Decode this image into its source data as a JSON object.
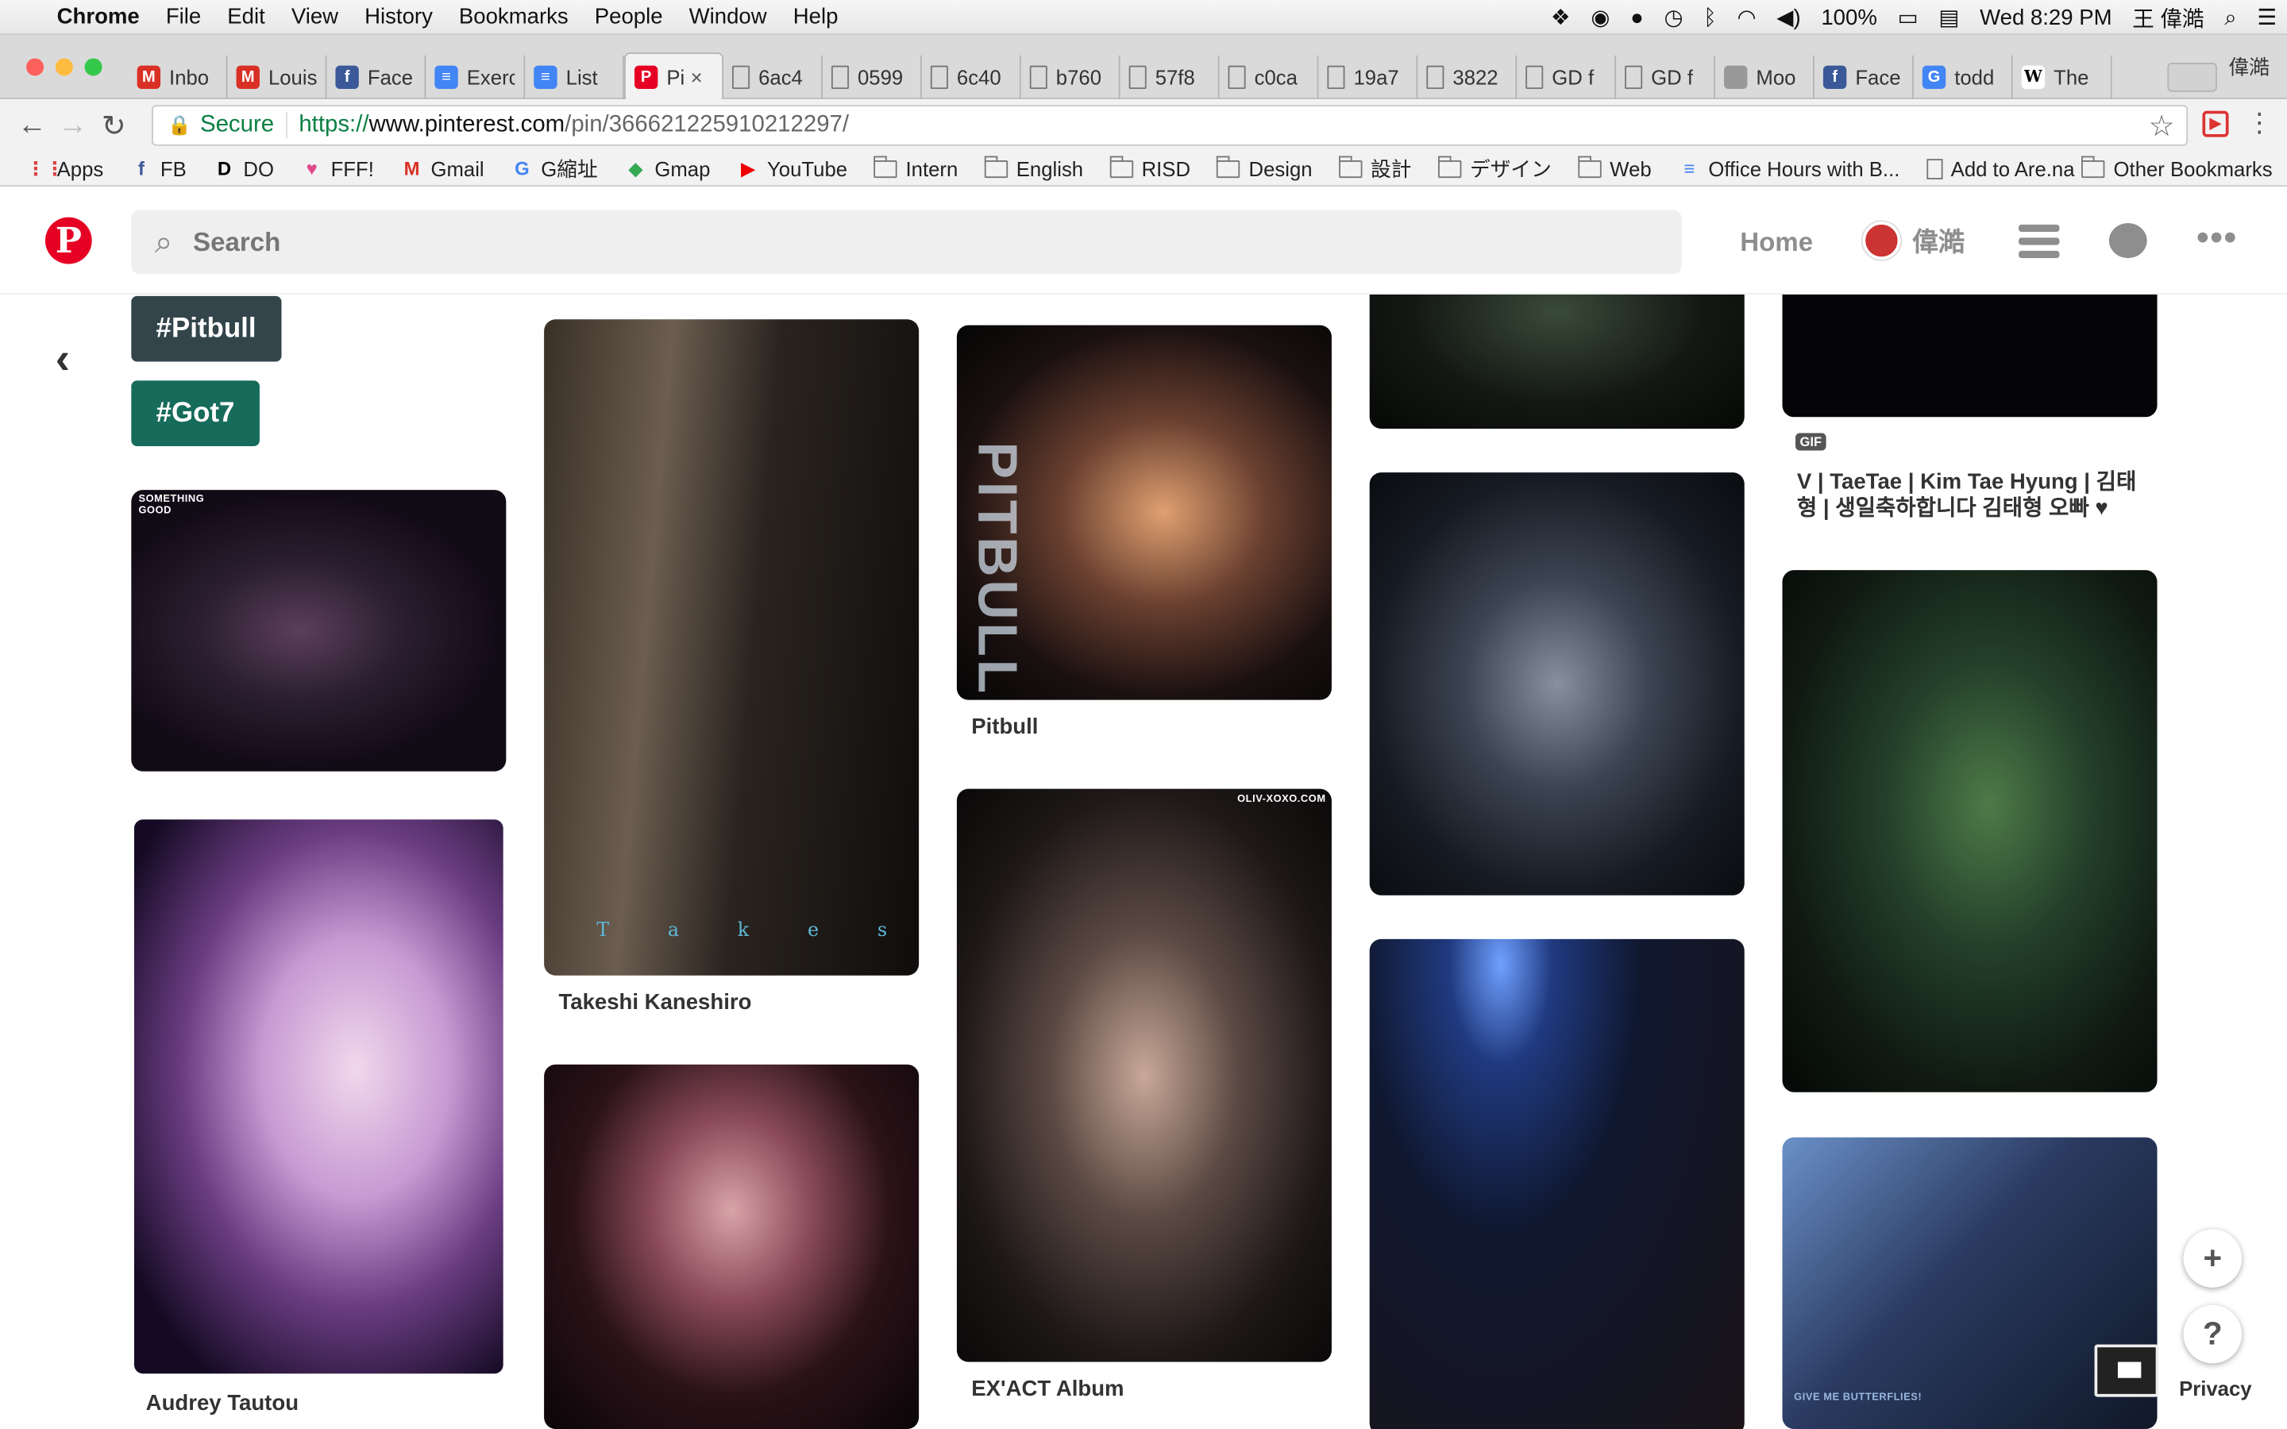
{
  "menubar": {
    "app_name": "Chrome",
    "items": [
      "File",
      "Edit",
      "View",
      "History",
      "Bookmarks",
      "People",
      "Window",
      "Help"
    ],
    "battery": "100%",
    "clock": "Wed 8:29 PM",
    "user": "王 偉澔"
  },
  "tabs": [
    {
      "title": "Inbo",
      "icon": "gmail-icon",
      "color": "#d93025",
      "glyph": "M"
    },
    {
      "title": "Louis",
      "icon": "gmail-icon",
      "color": "#d93025",
      "glyph": "M"
    },
    {
      "title": "Face",
      "icon": "facebook-icon",
      "color": "#3b5998",
      "glyph": "f"
    },
    {
      "title": "Exerc",
      "icon": "google-docs-icon",
      "color": "#4285f4",
      "glyph": "≡"
    },
    {
      "title": "List",
      "icon": "google-docs-icon",
      "color": "#4285f4",
      "glyph": "≡"
    },
    {
      "title": "Pi",
      "icon": "pinterest-icon",
      "color": "#e60023",
      "glyph": "P",
      "active": true
    },
    {
      "title": "6ac4",
      "icon": "page-icon",
      "color": "",
      "glyph": ""
    },
    {
      "title": "0599",
      "icon": "page-icon",
      "color": "",
      "glyph": ""
    },
    {
      "title": "6c40",
      "icon": "page-icon",
      "color": "",
      "glyph": ""
    },
    {
      "title": "b760",
      "icon": "page-icon",
      "color": "",
      "glyph": ""
    },
    {
      "title": "57f8",
      "icon": "page-icon",
      "color": "",
      "glyph": ""
    },
    {
      "title": "c0ca",
      "icon": "page-icon",
      "color": "",
      "glyph": ""
    },
    {
      "title": "19a7",
      "icon": "page-icon",
      "color": "",
      "glyph": ""
    },
    {
      "title": "3822",
      "icon": "page-icon",
      "color": "",
      "glyph": ""
    },
    {
      "title": "GD f",
      "icon": "page-icon",
      "color": "",
      "glyph": ""
    },
    {
      "title": "GD f",
      "icon": "page-icon",
      "color": "",
      "glyph": ""
    },
    {
      "title": "Moo",
      "icon": "mood-icon",
      "color": "#999",
      "glyph": ""
    },
    {
      "title": "Face",
      "icon": "facebook-icon",
      "color": "#3b5998",
      "glyph": "f"
    },
    {
      "title": "todd",
      "icon": "google-icon",
      "color": "#4285f4",
      "glyph": "G"
    },
    {
      "title": "The",
      "icon": "wikipedia-icon",
      "color": "#fff",
      "glyph": "W"
    }
  ],
  "profile_name": "偉澔",
  "toolbar": {
    "secure_label": "Secure",
    "url_scheme": "https://",
    "url_host": "www.pinterest.com",
    "url_path": "/pin/366621225910212297/"
  },
  "bookmarks": [
    {
      "label": "Apps",
      "icon": "apps-grid-icon"
    },
    {
      "label": "FB",
      "icon": "facebook-icon"
    },
    {
      "label": "DO",
      "icon": "do-icon"
    },
    {
      "label": "FFF!",
      "icon": "heart-icon"
    },
    {
      "label": "Gmail",
      "icon": "gmail-icon"
    },
    {
      "label": "G縮址",
      "icon": "google-icon"
    },
    {
      "label": "Gmap",
      "icon": "maps-icon"
    },
    {
      "label": "YouTube",
      "icon": "youtube-icon"
    },
    {
      "label": "Intern",
      "icon": "folder-icon"
    },
    {
      "label": "English",
      "icon": "folder-icon"
    },
    {
      "label": "RISD",
      "icon": "folder-icon"
    },
    {
      "label": "Design",
      "icon": "folder-icon"
    },
    {
      "label": "設計",
      "icon": "folder-icon"
    },
    {
      "label": "デザイン",
      "icon": "folder-icon"
    },
    {
      "label": "Web",
      "icon": "folder-icon"
    },
    {
      "label": "Office Hours with B...",
      "icon": "google-docs-icon"
    },
    {
      "label": "Add to Are.na",
      "icon": "page-icon"
    }
  ],
  "other_bookmarks": "Other Bookmarks",
  "pinterest": {
    "search_placeholder": "Search",
    "home_label": "Home",
    "user_name": "偉澔"
  },
  "tags": [
    {
      "label": "#Pitbull",
      "color": "#33454b"
    },
    {
      "label": "#Got7",
      "color": "#176b5b"
    }
  ],
  "pins": {
    "got7_tiny_text": "SOMETHING GOOD",
    "takeshi": "Takeshi Kaneshiro",
    "takeshi_overlay": "T a k e s h i",
    "pitbull": "Pitbull",
    "pitbull_overlay": "PITBULL",
    "exact": "EX'ACT Album",
    "exact_watermark": "OLIV-XOXO.COM",
    "audrey": "Audrey Tautou",
    "gif_badge": "GIF",
    "v_title": "V | TaeTae | Kim Tae Hyung | 김태형 | 생일축하합니다 김태형 오빠 ♥",
    "butterflies_text": "GIVE ME BUTTERFLIES!"
  },
  "floaters": {
    "plus": "+",
    "help": "?",
    "privacy": "Privacy"
  }
}
